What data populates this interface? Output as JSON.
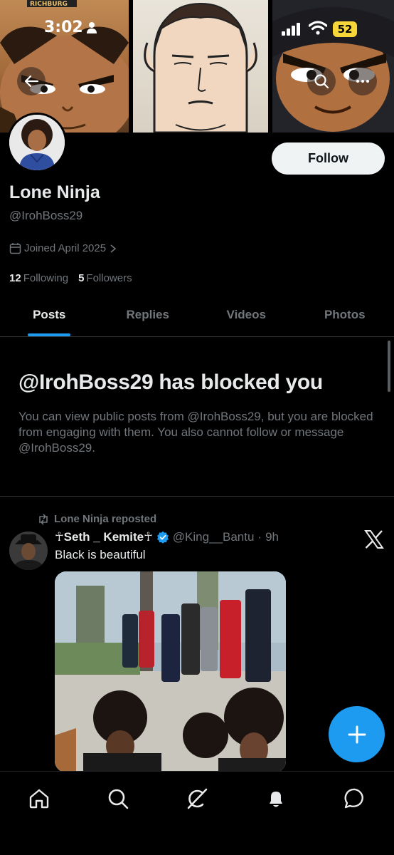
{
  "status_bar": {
    "time": "3:02",
    "battery": "52"
  },
  "banner": {
    "logo_text": "RICHBURG"
  },
  "profile": {
    "name": "Lone Ninja",
    "handle": "@IrohBoss29",
    "joined": "Joined April 2025",
    "following_count": "12",
    "following_label": "Following",
    "followers_count": "5",
    "followers_label": "Followers",
    "follow_label": "Follow"
  },
  "tabs": [
    {
      "label": "Posts"
    },
    {
      "label": "Replies"
    },
    {
      "label": "Videos"
    },
    {
      "label": "Photos"
    }
  ],
  "blocked": {
    "title": "@IrohBoss29 has blocked you",
    "body": "You can view public posts from @IrohBoss29, but you are blocked from engaging with them. You also cannot follow or message @IrohBoss29."
  },
  "post": {
    "repost_label": "Lone Ninja reposted",
    "author_name": "☥Seth _ Kemite☥",
    "author_handle": "@King__Bantu",
    "separator": "·",
    "time": "9h",
    "text": "Black is beautiful"
  },
  "colors": {
    "accent": "#1d9bf0",
    "verified": "#1d9bf0",
    "muted": "#71767b"
  },
  "icons": [
    "back-arrow-icon",
    "search-icon",
    "more-icon",
    "calendar-icon",
    "chevron-right-icon",
    "repost-icon",
    "verified-icon",
    "x-logo-icon",
    "plus-icon",
    "home-icon",
    "grok-icon",
    "bell-icon",
    "messages-icon"
  ]
}
